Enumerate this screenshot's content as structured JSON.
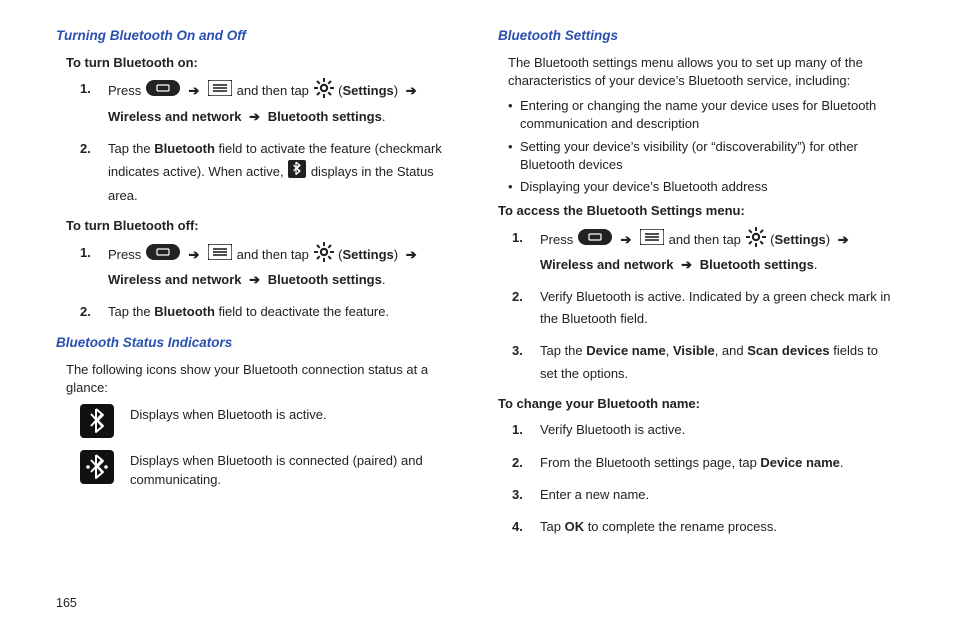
{
  "page_number": "165",
  "left": {
    "heading1": "Turning Bluetooth On and Off",
    "on_label": "To turn Bluetooth on:",
    "on_steps": [
      {
        "pre": "Press ",
        "mid": " and then tap ",
        "settings": "Settings",
        "after1": "Wireless and network",
        "after2": "Bluetooth settings",
        "suffix": "."
      },
      {
        "pre": "Tap the ",
        "b1": "Bluetooth",
        "mid": " field to activate the feature (checkmark indicates active). When active, ",
        "post": " displays in the Status area."
      }
    ],
    "off_label": "To turn Bluetooth off:",
    "off_steps": [
      {
        "pre": "Press ",
        "mid": " and then tap ",
        "settings": "Settings",
        "after1": "Wireless and network",
        "after2": "Bluetooth settings",
        "suffix": "."
      },
      {
        "pre": "Tap the ",
        "b1": "Bluetooth",
        "post": " field to deactivate the feature."
      }
    ],
    "heading2": "Bluetooth Status Indicators",
    "status_intro": "The following icons show your Bluetooth connection status at a glance:",
    "status1": "Displays when Bluetooth is active.",
    "status2": "Displays when Bluetooth is connected (paired) and communicating."
  },
  "right": {
    "heading1": "Bluetooth Settings",
    "intro": "The Bluetooth settings menu allows you to set up many of the characteristics of your device’s Bluetooth service, including:",
    "bullets": [
      "Entering or changing the name your device uses for Bluetooth communication and description",
      "Setting your device’s visibility (or “discoverability”) for other Bluetooth devices",
      "Displaying your device’s Bluetooth address"
    ],
    "access_label": "To access the Bluetooth Settings menu:",
    "access_steps": [
      {
        "pre": "Press ",
        "mid": " and then tap ",
        "settings": "Settings",
        "after1": "Wireless and network",
        "after2": "Bluetooth settings",
        "suffix": "."
      },
      {
        "text": "Verify Bluetooth is active. Indicated by a green check mark in the Bluetooth field."
      },
      {
        "pre": "Tap the ",
        "b1": "Device name",
        "sep1": ", ",
        "b2": "Visible",
        "sep2": ", and ",
        "b3": "Scan devices",
        "post": " fields to set the options."
      }
    ],
    "change_label": "To change your Bluetooth name:",
    "change_steps": [
      "Verify Bluetooth is active.",
      {
        "pre": "From the Bluetooth settings page, tap ",
        "b1": "Device name",
        "post": "."
      },
      "Enter a new name.",
      {
        "pre": "Tap ",
        "b1": "OK",
        "post": " to complete the rename process."
      }
    ]
  }
}
